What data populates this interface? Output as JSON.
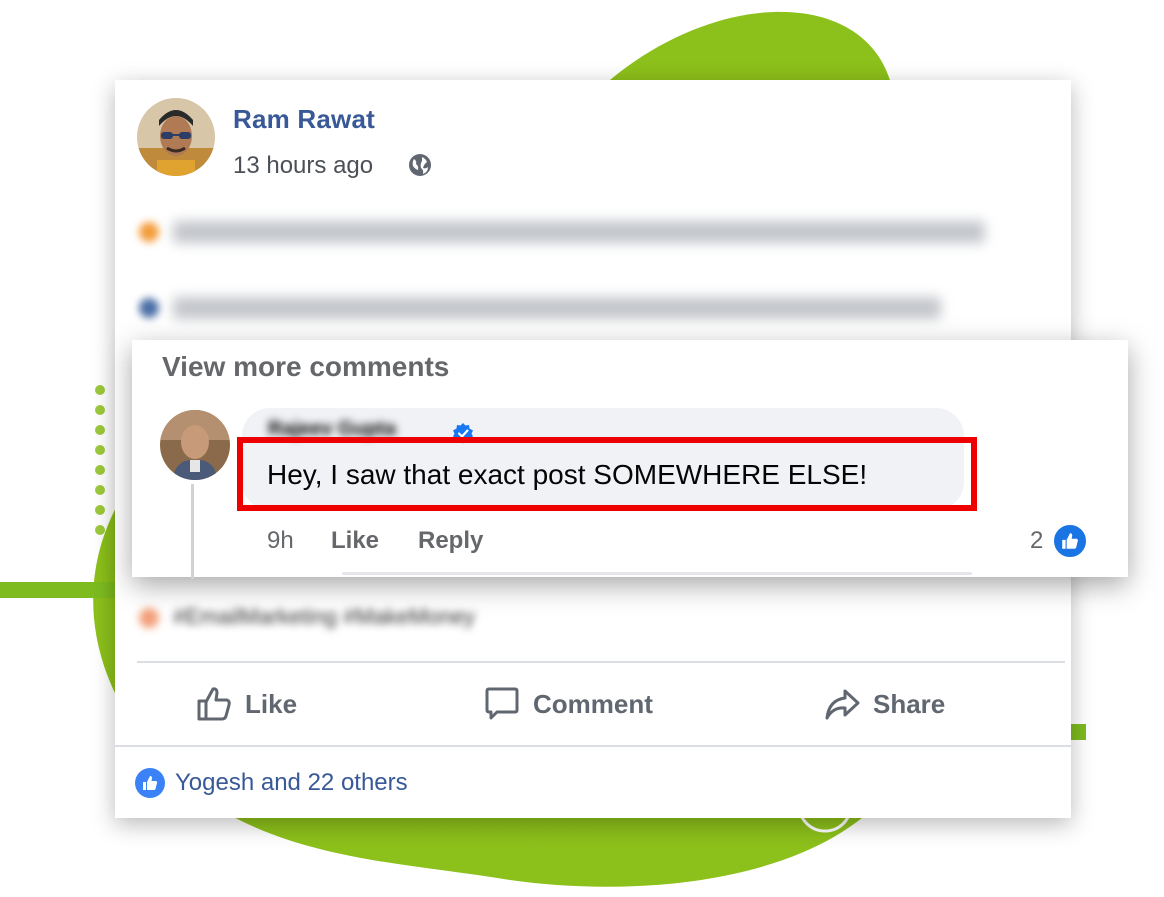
{
  "colors": {
    "brand_green": "#8cc01b",
    "link_blue": "#385898",
    "like_blue": "#1b74e4",
    "highlight_red": "#ee0000"
  },
  "post": {
    "author": "Ram Rawat",
    "time": "13 hours ago",
    "privacy_icon": "globe-icon",
    "hashtags": "#EmailMarketing #MakeMoney",
    "actions": {
      "like": "Like",
      "comment": "Comment",
      "share": "Share"
    },
    "reactions_summary": "Yogesh and 22 others"
  },
  "comments": {
    "view_more": "View more comments",
    "items": [
      {
        "author": "Rajeev Gupta",
        "verified": true,
        "text": "Hey, I saw that exact post SOMEWHERE ELSE!",
        "time": "9h",
        "like_label": "Like",
        "reply_label": "Reply",
        "reaction_count": "2"
      }
    ]
  }
}
